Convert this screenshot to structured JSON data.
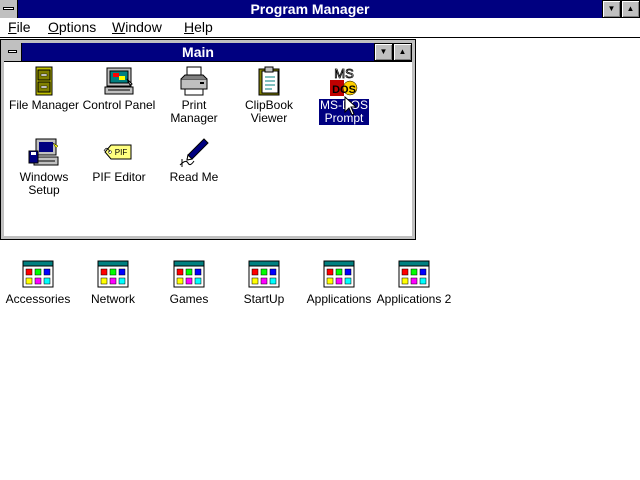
{
  "program_manager": {
    "title": "Program Manager",
    "minimize_glyph": "▼",
    "maximize_glyph": "▲"
  },
  "menu": [
    {
      "label": "File",
      "accel": "F",
      "rest": "ile"
    },
    {
      "label": "Options",
      "accel": "O",
      "rest": "ptions"
    },
    {
      "label": "Window",
      "accel": "W",
      "rest": "indow"
    },
    {
      "label": "Help",
      "accel": "H",
      "rest": "elp"
    }
  ],
  "main_window": {
    "title": "Main",
    "minimize_glyph": "▼",
    "maximize_glyph": "▲",
    "programs": [
      {
        "label": "File Manager",
        "icon": "file-cabinet-icon"
      },
      {
        "label": "Control Panel",
        "icon": "control-panel-icon"
      },
      {
        "label": "Print Manager",
        "icon": "printer-icon"
      },
      {
        "label": "ClipBook\nViewer",
        "icon": "clipbook-icon"
      },
      {
        "label": "MS-DOS\nPrompt",
        "icon": "ms-dos-icon",
        "selected": true
      },
      {
        "label": "Windows\nSetup",
        "icon": "computer-setup-icon"
      },
      {
        "label": "PIF Editor",
        "icon": "pif-tag-icon"
      },
      {
        "label": "Read Me",
        "icon": "pen-icon"
      }
    ]
  },
  "groups": [
    {
      "label": "Accessories"
    },
    {
      "label": "Network"
    },
    {
      "label": "Games"
    },
    {
      "label": "StartUp"
    },
    {
      "label": "Applications"
    },
    {
      "label": "Applications 2"
    }
  ],
  "msdos_icon_text": {
    "top": "MS",
    "bottom": "DOS"
  },
  "pif_icon_text": "PIF",
  "colors": {
    "title_active": "#000080",
    "window_frame": "#c0c0c0",
    "selection": "#000080",
    "desktop": "#ffffff"
  }
}
